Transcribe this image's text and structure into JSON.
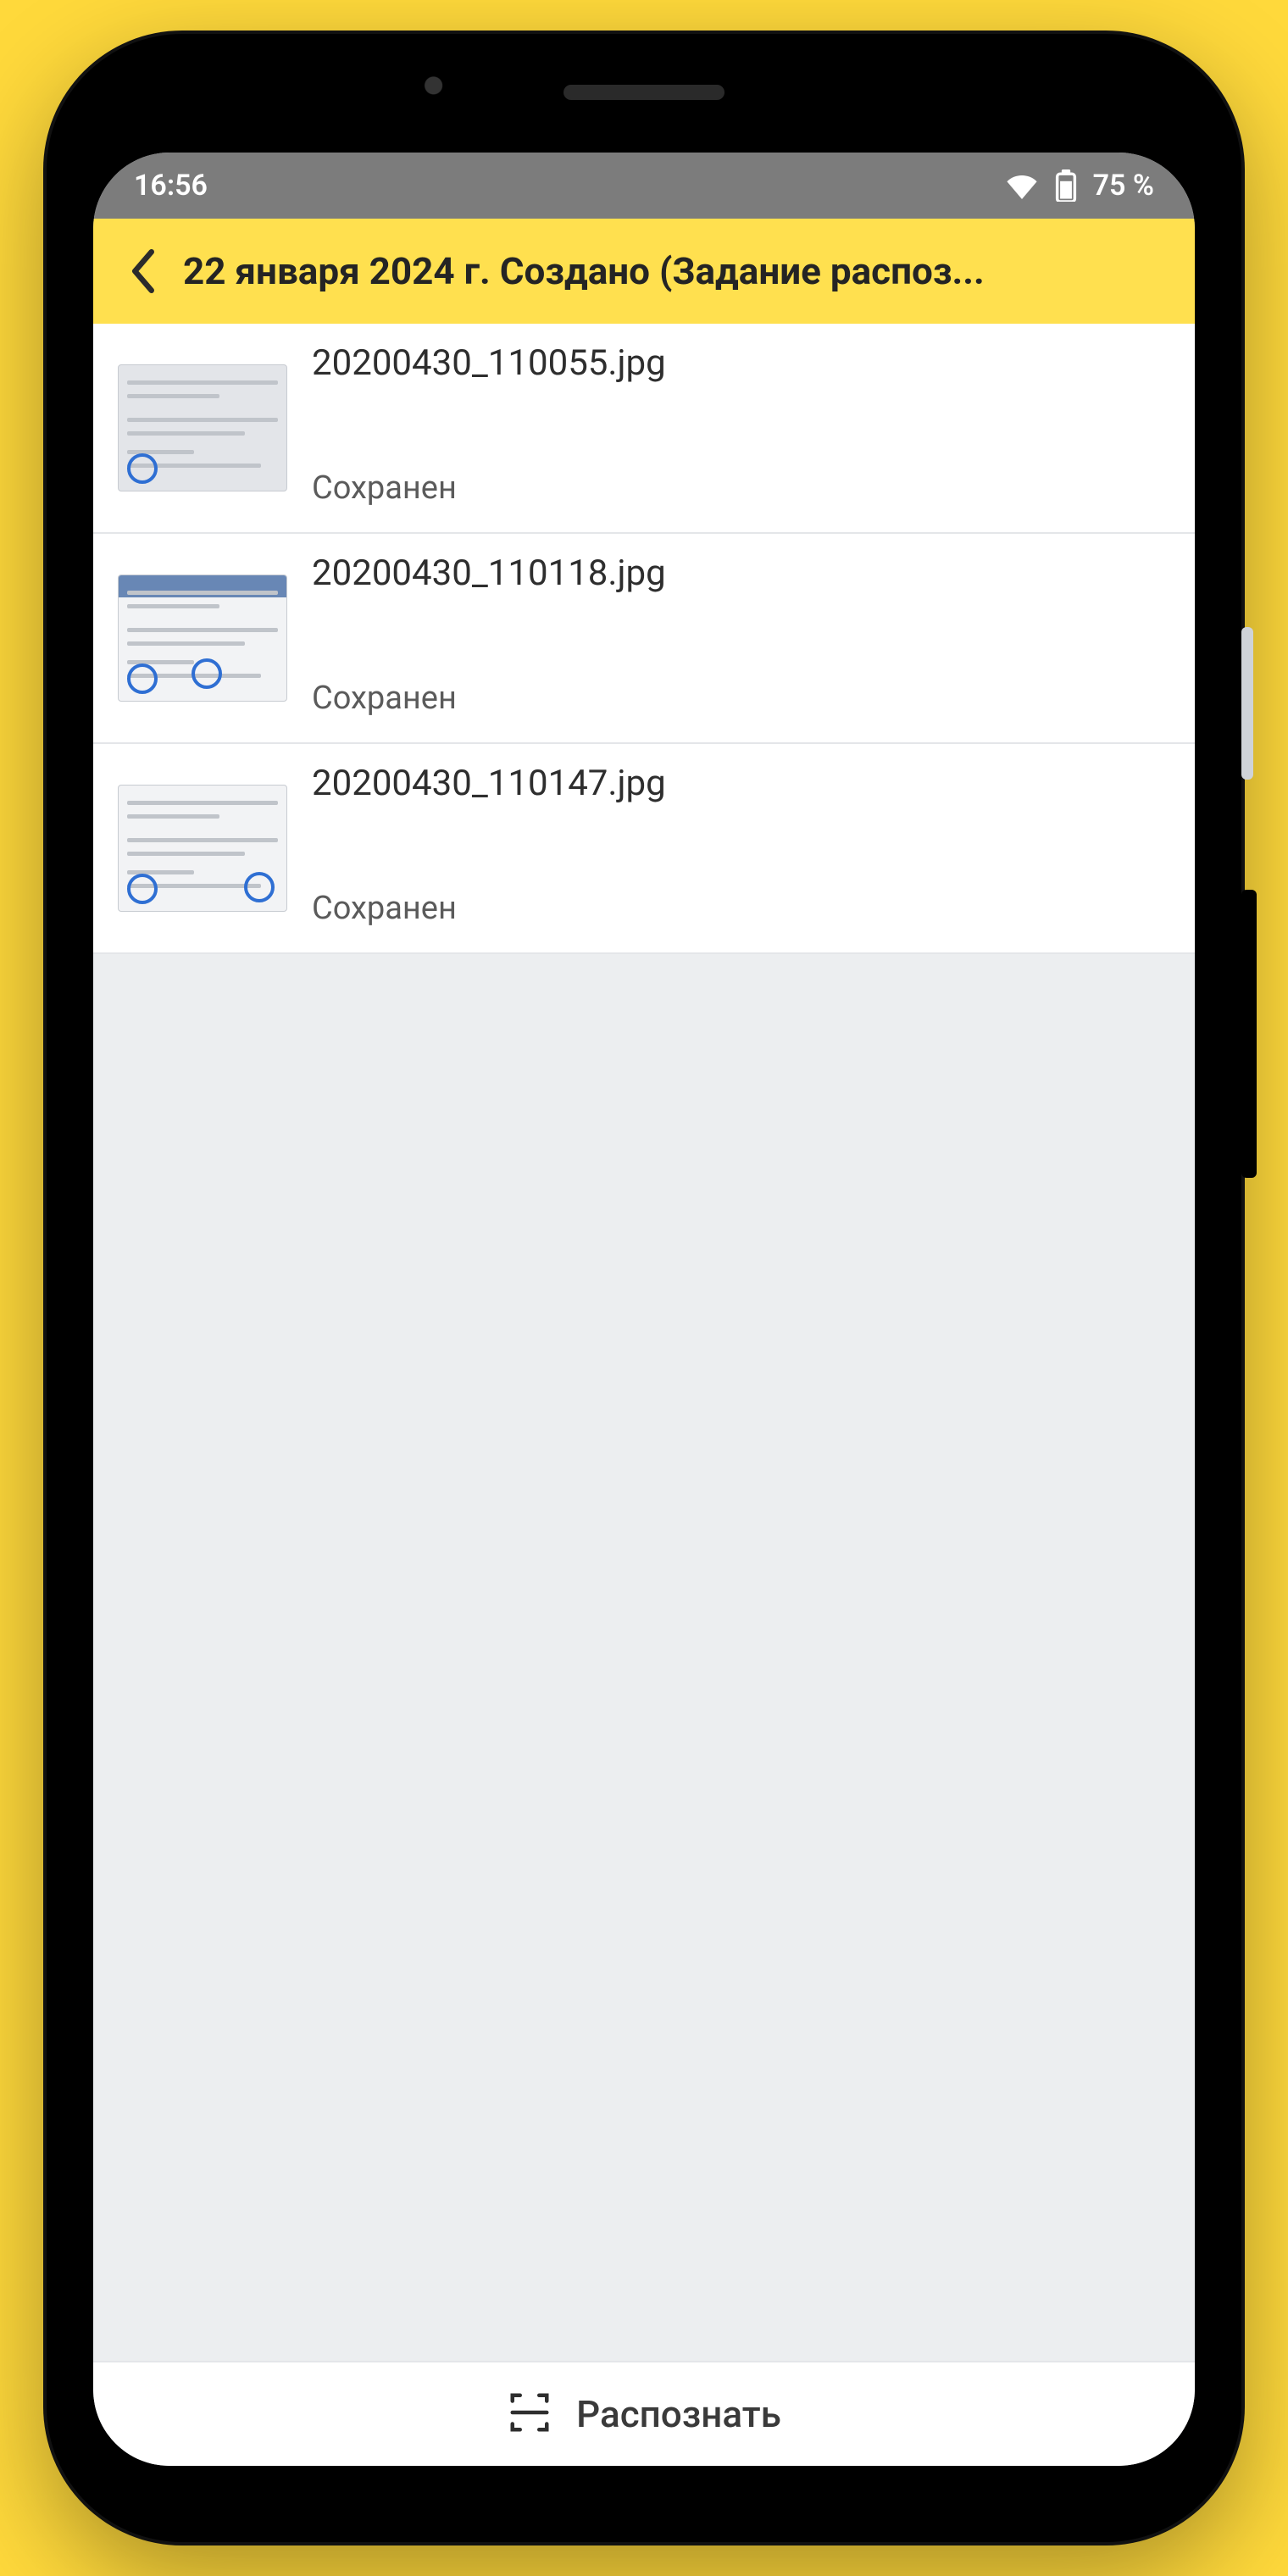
{
  "statusbar": {
    "time": "16:56",
    "battery_text": "75 %"
  },
  "header": {
    "title": "22 января 2024 г. Создано (Задание распоз..."
  },
  "files": [
    {
      "name": "20200430_110055.jpg",
      "status": "Сохранен",
      "thumb_style": "gray",
      "stamp": "bl"
    },
    {
      "name": "20200430_110118.jpg",
      "status": "Сохранен",
      "thumb_style": "bluehdr",
      "stamp": "bl mid"
    },
    {
      "name": "20200430_110147.jpg",
      "status": "Сохранен",
      "thumb_style": "",
      "stamp": "bl br"
    }
  ],
  "bottom": {
    "action_label": "Распознать"
  }
}
